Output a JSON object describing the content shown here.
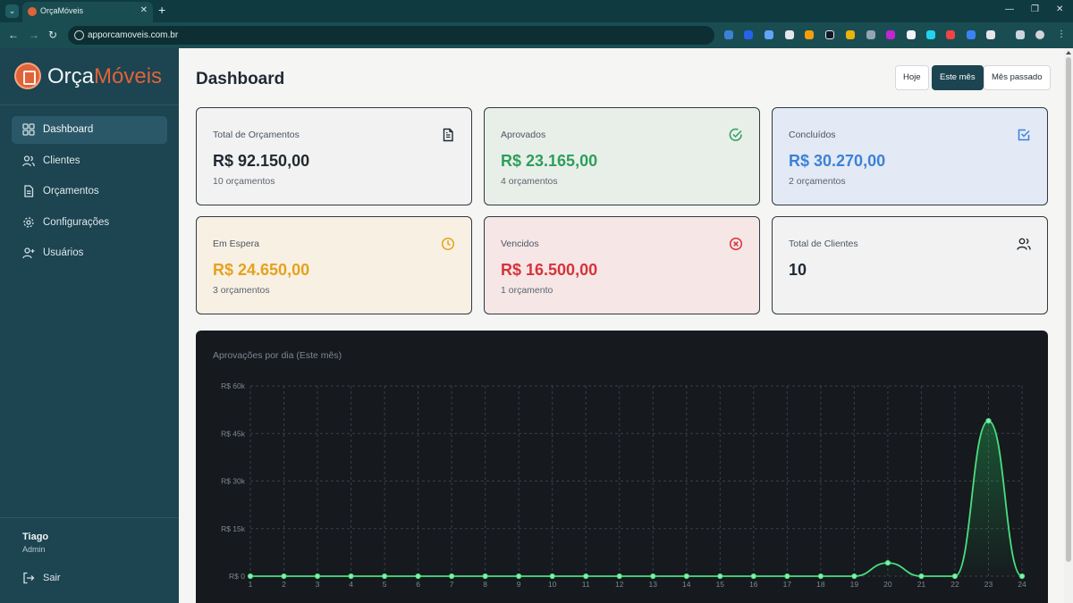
{
  "browser": {
    "tab_title": "OrçaMóveis",
    "url": "apporcamoveis.com.br"
  },
  "sidebar": {
    "logo_part1": "Orça",
    "logo_part2": "Móveis",
    "items": [
      {
        "label": "Dashboard",
        "icon": "dashboard-icon",
        "active": true
      },
      {
        "label": "Clientes",
        "icon": "users-icon",
        "active": false
      },
      {
        "label": "Orçamentos",
        "icon": "document-icon",
        "active": false
      },
      {
        "label": "Configurações",
        "icon": "gear-icon",
        "active": false
      },
      {
        "label": "Usuários",
        "icon": "user-add-icon",
        "active": false
      }
    ],
    "user": {
      "name": "Tiago",
      "role": "Admin"
    },
    "logout_label": "Sair"
  },
  "header": {
    "title": "Dashboard",
    "periods": [
      {
        "label": "Hoje",
        "active": false
      },
      {
        "label": "Este mês",
        "active": true
      },
      {
        "label": "Mês passado",
        "active": false
      }
    ]
  },
  "cards": [
    {
      "label": "Total de Orçamentos",
      "value": "R$ 92.150,00",
      "sub": "10 orçamentos",
      "icon": "file-text-icon",
      "color": "#1f2933",
      "bg": "#f2f2f2"
    },
    {
      "label": "Aprovados",
      "value": "R$ 23.165,00",
      "sub": "4 orçamentos",
      "icon": "check-circle-icon",
      "color": "#2f9e5b",
      "bg": "#e8efe9"
    },
    {
      "label": "Concluídos",
      "value": "R$ 30.270,00",
      "sub": "2 orçamentos",
      "icon": "check-square-icon",
      "color": "#3b82d6",
      "bg": "#e3e9f5"
    },
    {
      "label": "Em Espera",
      "value": "R$ 24.650,00",
      "sub": "3 orçamentos",
      "icon": "clock-icon",
      "color": "#e6a11f",
      "bg": "#f8f0e2"
    },
    {
      "label": "Vencidos",
      "value": "R$ 16.500,00",
      "sub": "1 orçamento",
      "icon": "x-circle-icon",
      "color": "#d6333b",
      "bg": "#f6e6e6"
    },
    {
      "label": "Total de Clientes",
      "value": "10",
      "sub": "",
      "icon": "users-icon",
      "color": "#1f2933",
      "bg": "#f2f2f2"
    }
  ],
  "chart_data": {
    "type": "area",
    "title": "Aprovações por dia (Este mês)",
    "x": [
      1,
      2,
      3,
      4,
      5,
      6,
      7,
      8,
      9,
      10,
      11,
      12,
      13,
      14,
      15,
      16,
      17,
      18,
      19,
      20,
      21,
      22,
      23,
      24
    ],
    "values": [
      0,
      0,
      0,
      0,
      0,
      0,
      0,
      0,
      0,
      0,
      0,
      0,
      0,
      0,
      0,
      0,
      0,
      0,
      0,
      4200,
      0,
      0,
      49000,
      0
    ],
    "y_ticks": [
      "R$ 0",
      "R$ 15k",
      "R$ 30k",
      "R$ 45k",
      "R$ 60k"
    ],
    "ylim": [
      0,
      60000
    ],
    "grid": true,
    "line_color": "#4ade80"
  }
}
